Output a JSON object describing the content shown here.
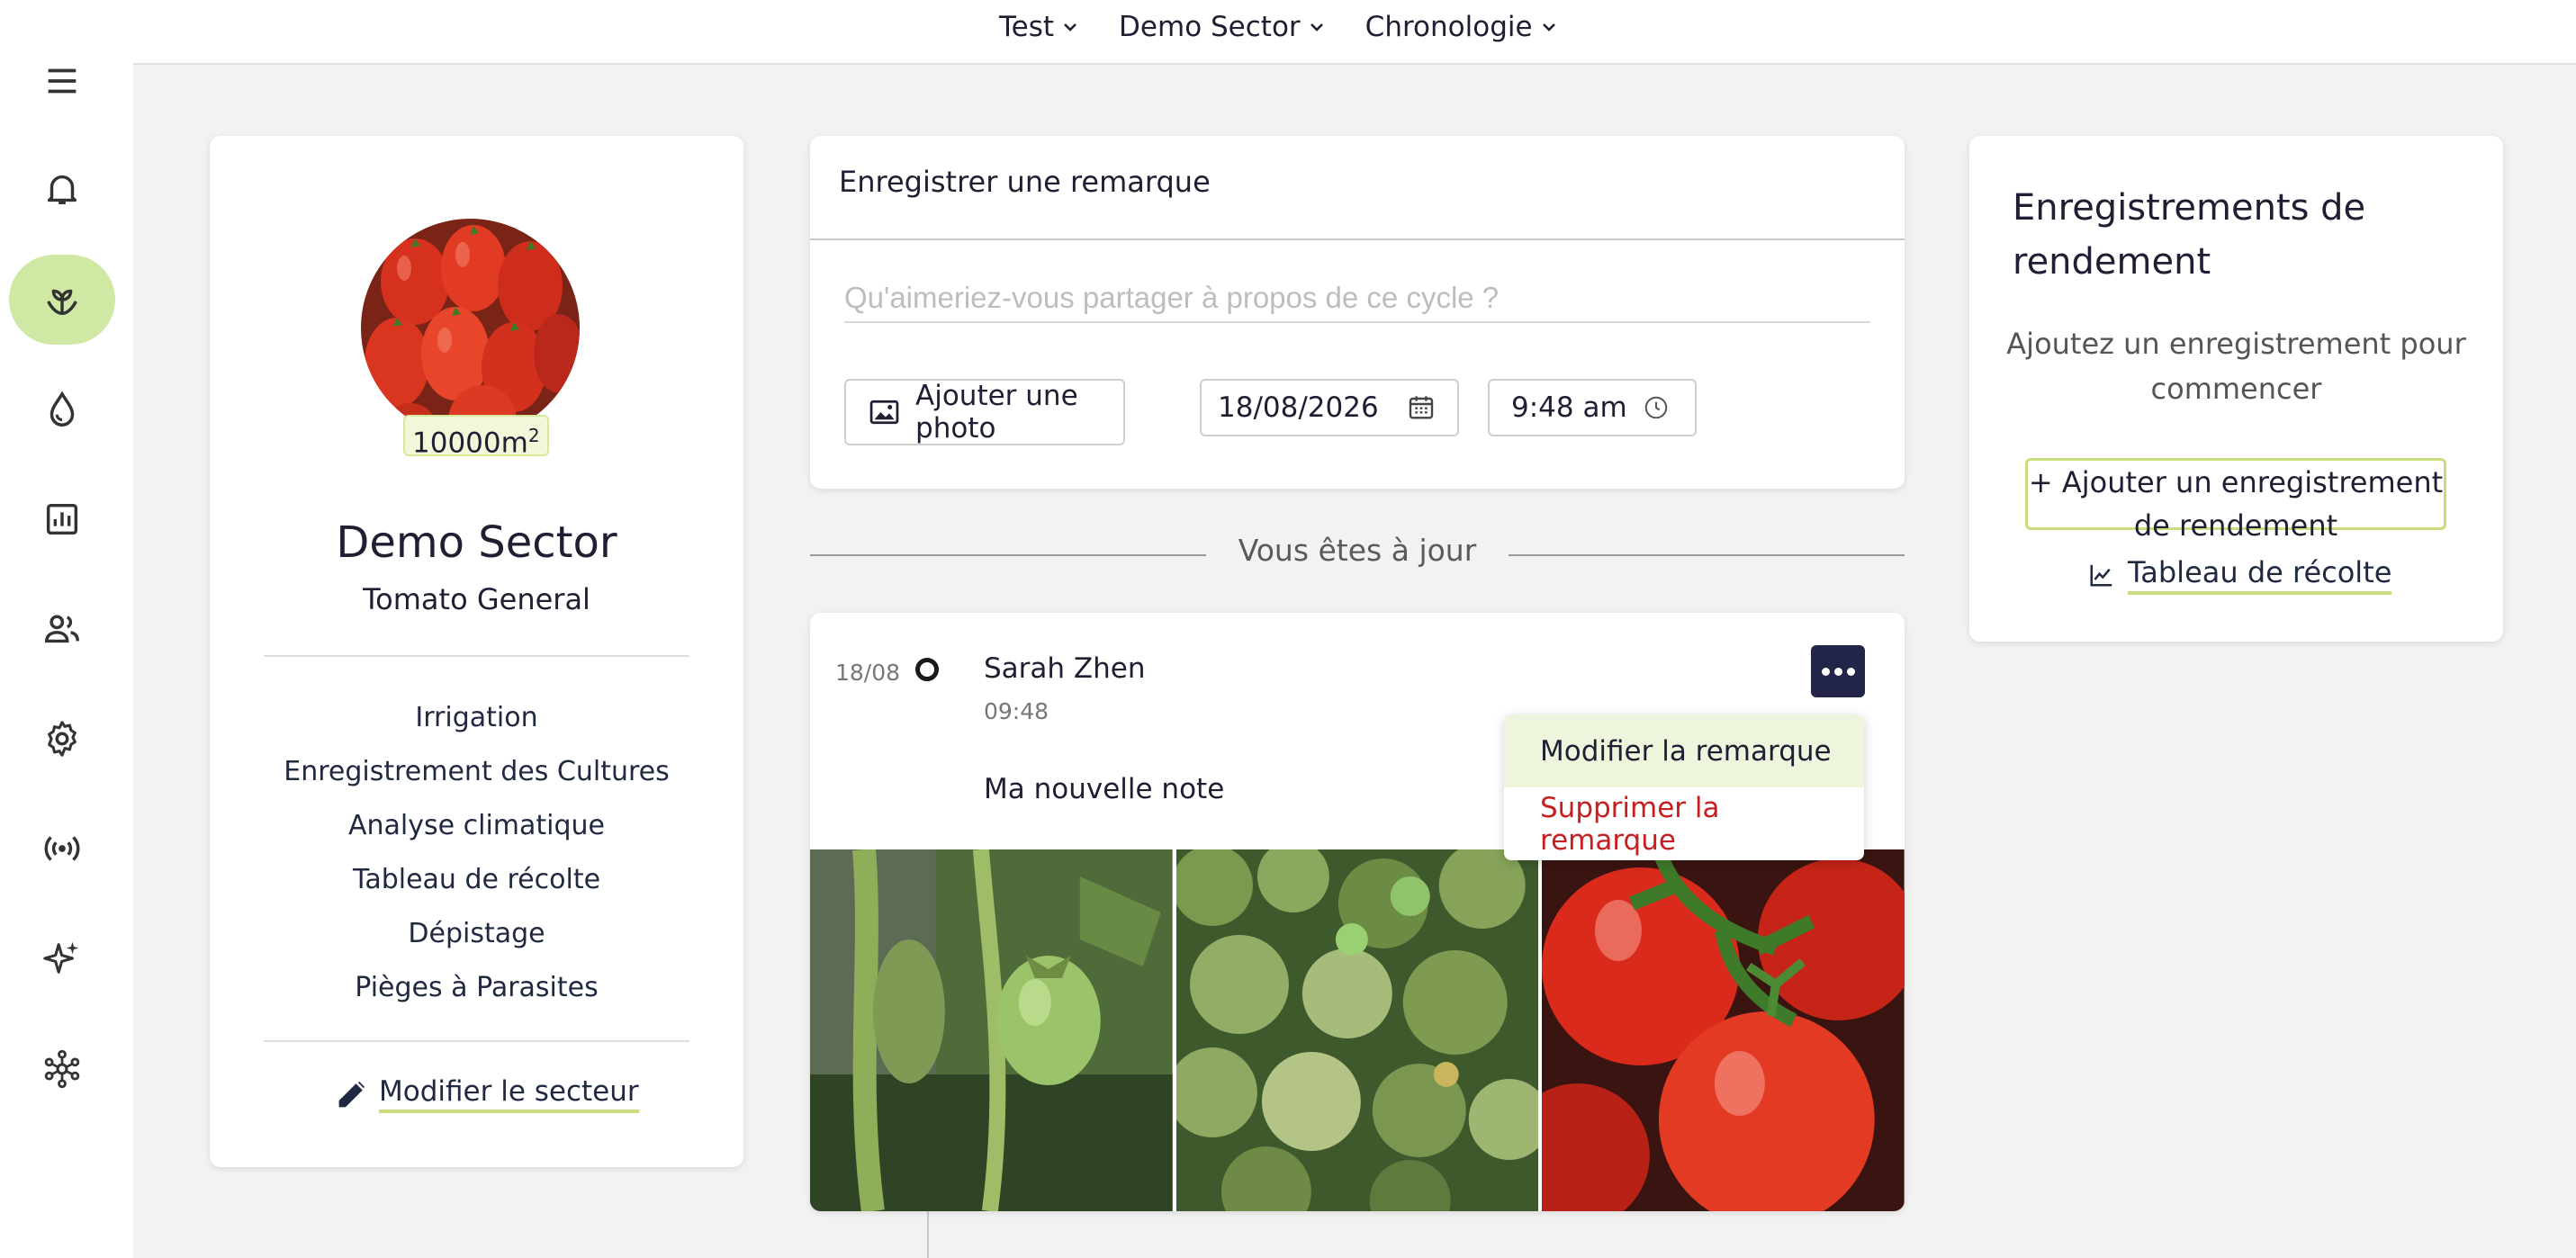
{
  "topnav": {
    "items": [
      {
        "label": "Test"
      },
      {
        "label": "Demo Sector"
      },
      {
        "label": "Chronologie"
      }
    ]
  },
  "sidebar": {
    "icons": [
      "menu-icon",
      "bell-icon",
      "sprout-icon",
      "droplet-icon",
      "chart-icon",
      "users-icon",
      "gear-icon",
      "broadcast-icon",
      "sparkle-icon",
      "network-icon"
    ],
    "active_color": "#cfe8a4"
  },
  "sector": {
    "area": "10000m",
    "area_unit_exp": "2",
    "name": "Demo Sector",
    "crop": "Tomato General",
    "links": [
      {
        "label": "Irrigation"
      },
      {
        "label": "Enregistrement des Cultures"
      },
      {
        "label": "Analyse climatique"
      },
      {
        "label": "Tableau de récolte"
      },
      {
        "label": "Dépistage"
      },
      {
        "label": "Pièges à Parasites"
      }
    ],
    "edit_label": "Modifier le secteur"
  },
  "remark": {
    "title": "Enregistrer une remarque",
    "placeholder": "Qu'aimeriez-vous partager à propos de ce cycle ?",
    "photo_label": "Ajouter une photo",
    "date": "18/08/2026",
    "time": "9:48 am"
  },
  "feed": {
    "uptodate": "Vous êtes à jour",
    "note": {
      "date": "18/08",
      "author": "Sarah Zhen",
      "time": "09:48",
      "text": "Ma nouvelle note"
    },
    "menu": {
      "edit": "Modifier la remarque",
      "delete": "Supprimer la remarque"
    }
  },
  "yield": {
    "title": "Enregistrements de rendement",
    "subtitle": "Ajoutez un enregistrement pour commencer",
    "add_label": "+ Ajouter un enregistrement de rendement",
    "harvest_link": "Tableau de récolte"
  },
  "colors": {
    "accent_green": "#c8de7c",
    "navy": "#222449",
    "danger": "#c71f1f"
  }
}
